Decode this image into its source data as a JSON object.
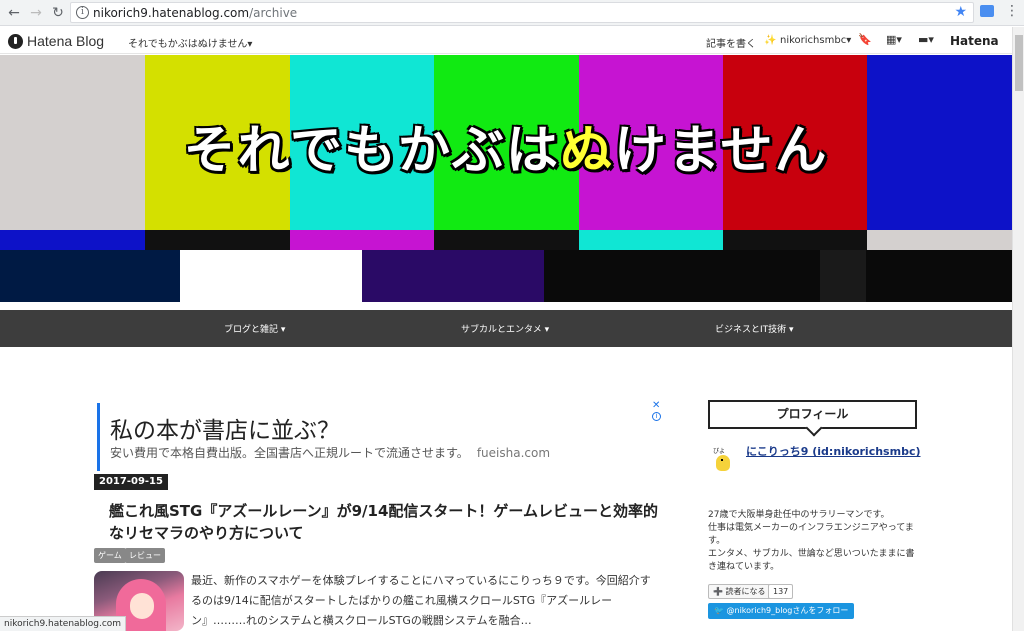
{
  "browser": {
    "back_icon": "←",
    "forward_icon": "→",
    "reload_icon": "↻",
    "info_icon": "i",
    "url_host": "nikorich9.hatenablog.com",
    "url_path": "/archive",
    "star_icon": "★",
    "menu_icon": "⋮"
  },
  "hatena_bar": {
    "logo_text": "Hatena Blog",
    "blog_name": "それでもかぶはぬけません▾",
    "write_article": "記事を書く",
    "user_name": "nikorichsmbc▾",
    "user_icon": "✨",
    "bookmark_icon": "🔖",
    "grid_icon": "▦▾",
    "message_icon": "▬▾",
    "hatena_logo": "Hatena"
  },
  "header": {
    "title_before": "それでもかぶは",
    "title_highlight": "ぬ",
    "title_after": "けません",
    "bar_colors": [
      "#d4d0cf",
      "#d4e000",
      "#10e6d4",
      "#11ea12",
      "#c614d2",
      "#c8000d",
      "#0d12c8"
    ],
    "accent_yellow": "#ffff33"
  },
  "categories": [
    {
      "label": "ブログと雑記 ▾"
    },
    {
      "label": "サブカルとエンタメ ▾"
    },
    {
      "label": "ビジネスとIT技術 ▾"
    }
  ],
  "ad": {
    "title": "私の本が書店に並ぶ？",
    "body": "安い費用で本格自費出版。全国書店へ正規ルートで流通させます。",
    "domain": "fueisha.com",
    "close_icon": "✕",
    "info_icon": "i"
  },
  "article": {
    "date": "2017-09-15",
    "title": "艦これ風STG『アズールレーン』が9/14配信スタート！ゲームレビューと効率的なリセマラのやり方について",
    "tags": [
      "ゲーム",
      "レビュー"
    ],
    "summary": "最近、新作のスマホゲーを体験プレイすることにハマっているにこりっち９です。今回紹介するのは9/14に配信がスタートしたばかりの艦これ風横スクロールSTG『アズールレーン』………れのシステムと横スクロールSTGの戦闘システムを融合…"
  },
  "sidebar": {
    "profile_heading": "プロフィール",
    "avatar_label": "ぴよ",
    "profile_name": "にこりっち9 (id:nikorichsmbc)",
    "profile_desc_lines": [
      "27歳で大阪単身赴任中のサラリーマンです。",
      "仕事は電気メーカーのインフラエンジニアやってます。",
      "エンタメ、サブカル、世論など思いついたままに書き連ねています。"
    ],
    "reader_button": "➕ 読者になる",
    "reader_count": "137",
    "follow_button": "🐦 @nikorich9_blogさんをフォロー"
  },
  "statusbar": {
    "text": "nikorich9.hatenablog.com"
  }
}
